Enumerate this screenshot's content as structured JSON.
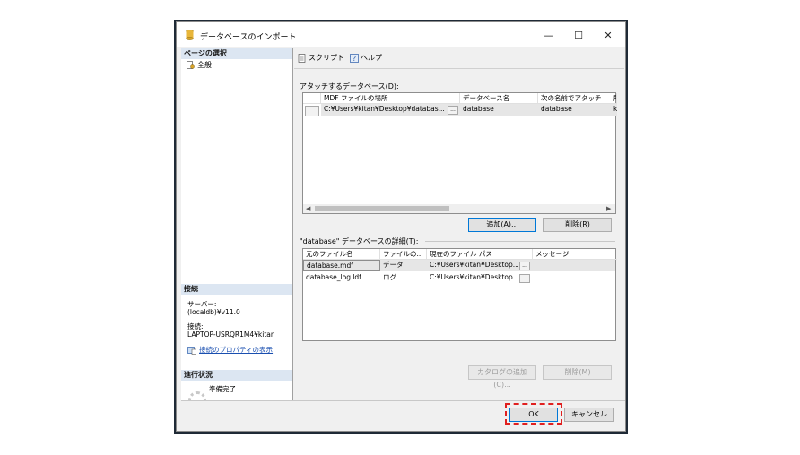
{
  "window": {
    "title": "データベースのインポート",
    "controls": {
      "minimize": "—",
      "maximize": "☐",
      "close": "✕"
    }
  },
  "left": {
    "page_select_header": "ページの選択",
    "pages": [
      {
        "label": "全般",
        "icon": "document-gear-icon"
      }
    ],
    "connection_header": "接続",
    "server_label": "サーバー:",
    "server_value": "(localdb)¥v11.0",
    "connection_label": "接続:",
    "connection_value": "LAPTOP-USRQR1M4¥kitan",
    "connection_props_link": "接続のプロパティの表示",
    "progress_header": "進行状況",
    "progress_status": "準備完了"
  },
  "toolbar": {
    "script_label": "スクリプト",
    "dropdown": "▾",
    "help_label": "ヘルプ"
  },
  "attach": {
    "label": "アタッチするデータベース(D):",
    "columns": [
      "MDF ファイルの場所",
      "データベース名",
      "次の名前でアタッチ",
      "所"
    ],
    "rows": [
      {
        "location": "C:¥Users¥kitan¥Desktop¥databas...",
        "browse": "...",
        "db_name": "database",
        "attach_as": "database",
        "owner": "k"
      }
    ],
    "add_button": "追加(A)...",
    "remove_button": "削除(R)"
  },
  "details": {
    "label": "\"database\" データベースの詳細(T):",
    "columns": [
      "元のファイル名",
      "ファイルの...",
      "現在のファイル パス",
      "メッセージ"
    ],
    "rows": [
      {
        "file": "database.mdf",
        "type": "データ",
        "path": "C:¥Users¥kitan¥Desktop...",
        "browse": "...",
        "message": ""
      },
      {
        "file": "database_log.ldf",
        "type": "ログ",
        "path": "C:¥Users¥kitan¥Desktop...",
        "browse": "...",
        "message": ""
      }
    ],
    "add_catalog_button": "カタログの追加(C)...",
    "remove_button": "削除(M)"
  },
  "footer": {
    "ok_button": "OK",
    "cancel_button": "キャンセル"
  },
  "colors": {
    "frame": "#1f2a36",
    "section_header": "#dce6f2",
    "link": "#1a4fb0",
    "highlight": "#e02020",
    "focus": "#0078d7"
  }
}
